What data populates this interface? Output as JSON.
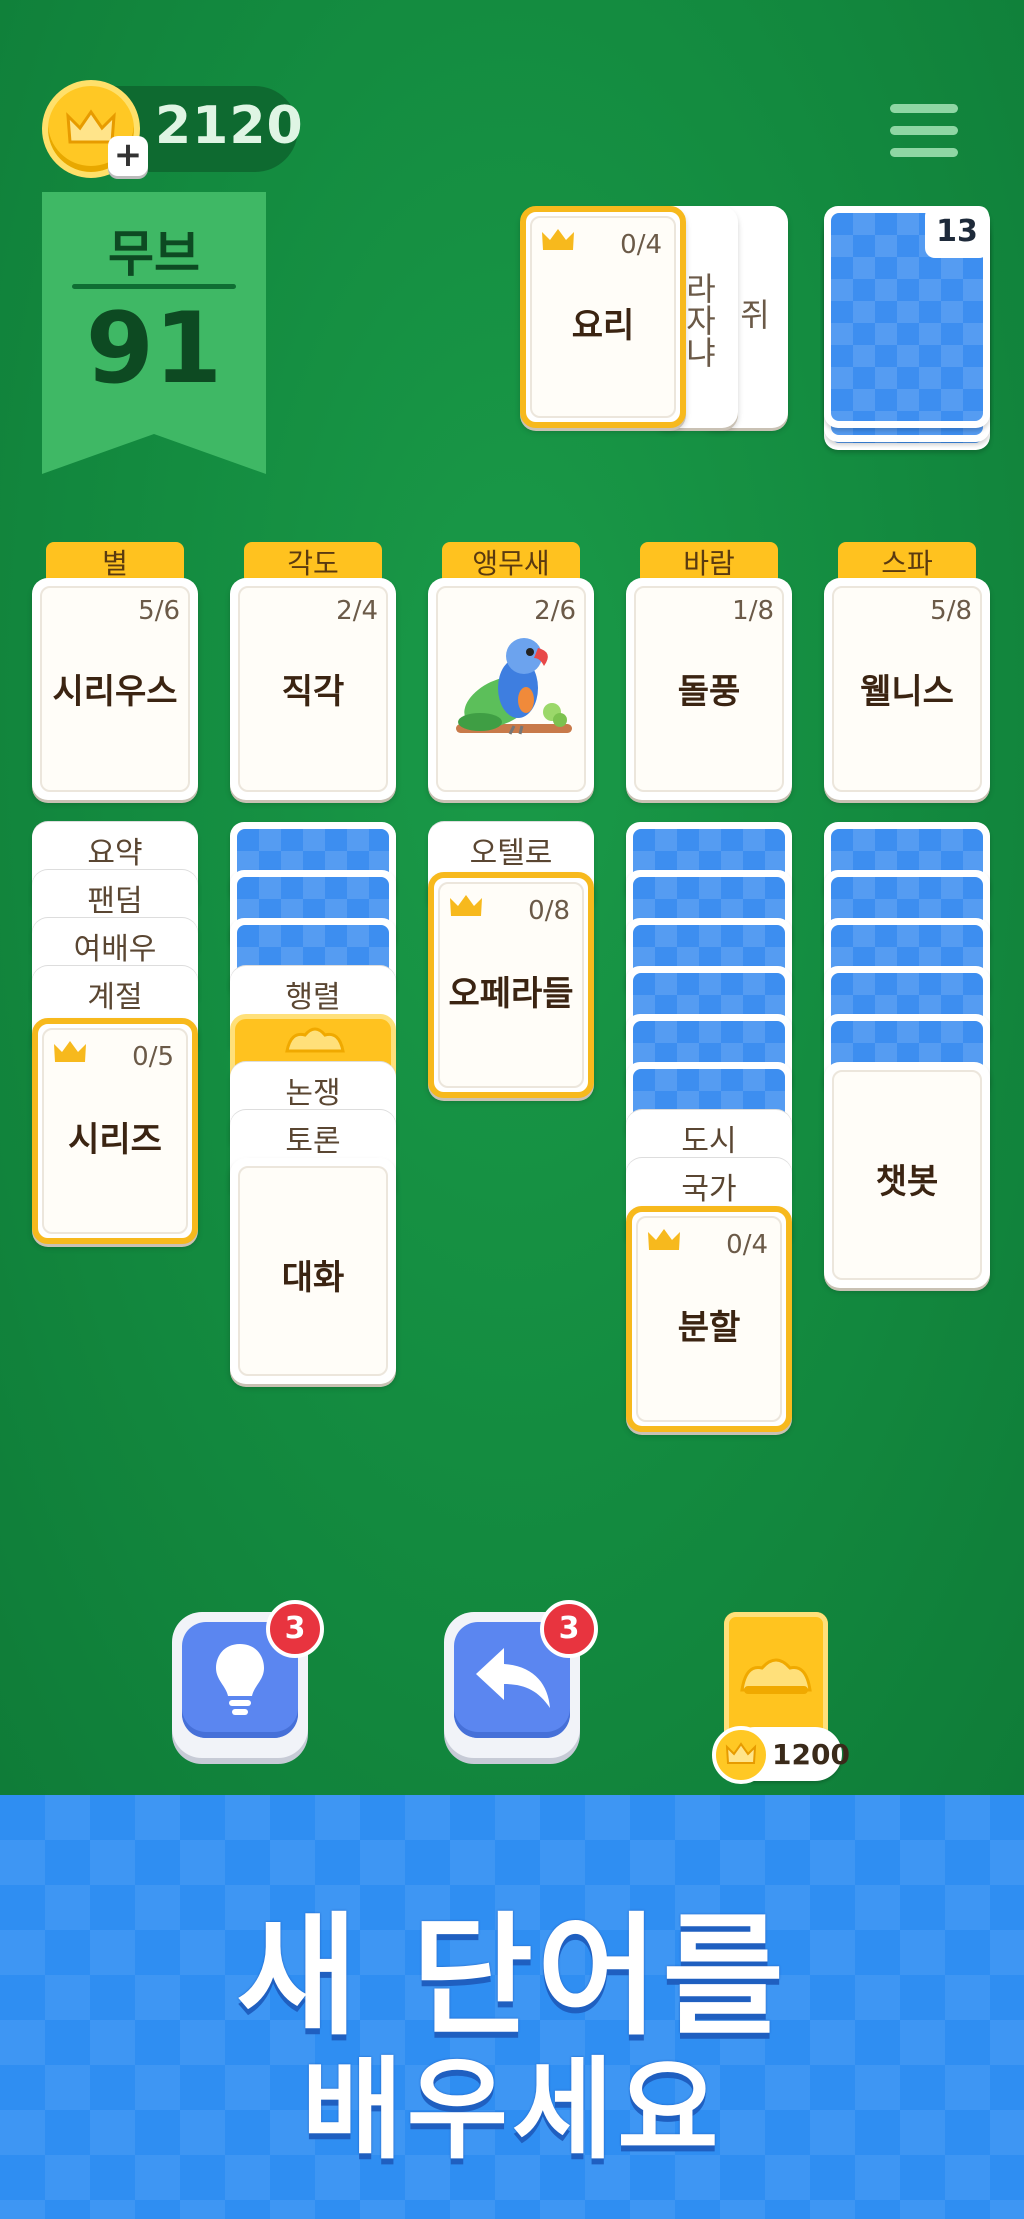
{
  "header": {
    "coins": "2120",
    "plus_symbol": "+",
    "level_label": "무브",
    "level_value": "91"
  },
  "top_row": {
    "active_card": {
      "word": "요리",
      "count": "0/4"
    },
    "fanned_words": [
      "라자냐",
      "쥐"
    ],
    "deck_remaining": "13"
  },
  "foundations": [
    {
      "category": "별",
      "word": "시리우스",
      "count": "5/6"
    },
    {
      "category": "각도",
      "word": "직각",
      "count": "2/4"
    },
    {
      "category": "앵무새",
      "word": "",
      "count": "2/6",
      "image": "parrot-illustration"
    },
    {
      "category": "바람",
      "word": "돌풍",
      "count": "1/8"
    },
    {
      "category": "스파",
      "word": "웰니스",
      "count": "5/8"
    }
  ],
  "tableau": {
    "col1": {
      "strips": [
        "요약",
        "팬덤",
        "여배우",
        "계절"
      ],
      "top": {
        "word": "시리즈",
        "count": "0/5"
      }
    },
    "col2": {
      "strips": [
        "행렬",
        "논쟁",
        "토론"
      ],
      "top": {
        "word": "대화"
      }
    },
    "col3": {
      "strips": [
        "오텔로"
      ],
      "top": {
        "word": "오페라들",
        "count": "0/8"
      }
    },
    "col4": {
      "strips": [
        "도시",
        "국가"
      ],
      "top": {
        "word": "분할",
        "count": "0/4"
      }
    },
    "col5": {
      "top": {
        "word": "챗봇"
      }
    }
  },
  "controls": {
    "hint_badge": "3",
    "undo_badge": "3",
    "joker_price": "1200"
  },
  "icons": [
    "crown-icon",
    "lightbulb-icon",
    "undo-icon",
    "joker-hat-icon",
    "menu-icon",
    "coin-icon"
  ],
  "colors": {
    "felt": "#138a3f",
    "gold": "#f7b91d",
    "card_back": "#3d8ef0",
    "badge": "#e8343f",
    "promo": "#2f8ef2"
  },
  "promo": {
    "line1": "새 단어를",
    "line2": "배우세요"
  }
}
